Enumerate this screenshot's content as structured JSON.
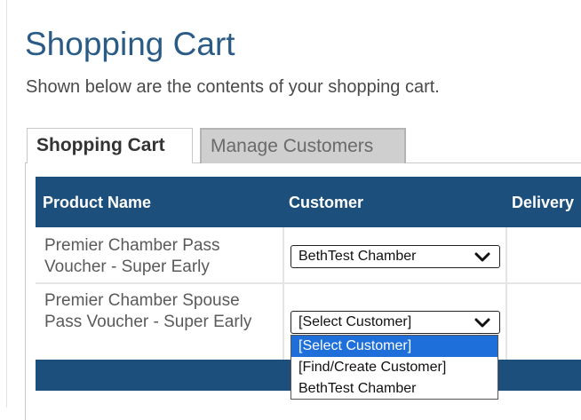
{
  "header": {
    "title": "Shopping Cart",
    "subtitle": "Shown below are the contents of your shopping cart."
  },
  "tabs": [
    {
      "label": "Shopping Cart",
      "active": true
    },
    {
      "label": "Manage Customers",
      "active": false
    }
  ],
  "table": {
    "columns": [
      "Product Name",
      "Customer",
      "Delivery"
    ],
    "rows": [
      {
        "product": "Premier Chamber Pass Voucher - Super Early",
        "customer": "BethTest Chamber"
      },
      {
        "product": "Premier Chamber Spouse Pass Voucher - Super Early",
        "customer": "[Select Customer]"
      }
    ]
  },
  "customer_dropdown": {
    "open": true,
    "options": [
      "[Select Customer]",
      "[Find/Create Customer]",
      "BethTest Chamber"
    ],
    "highlighted": "[Select Customer]"
  },
  "icons": {
    "select_arrow": "chevron-down-icon"
  },
  "colors": {
    "title": "#2a5b86",
    "table_header": "#1c4f7c",
    "highlight": "#1e6fd9"
  }
}
